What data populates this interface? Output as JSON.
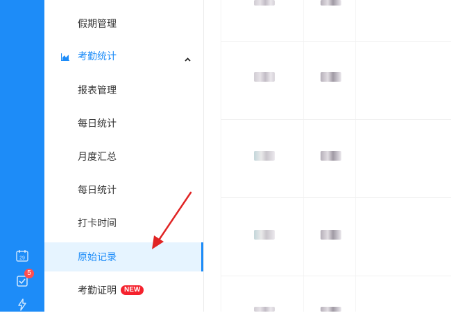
{
  "rail": {
    "calendar_day": "29",
    "task_badge": "5"
  },
  "menu": {
    "items_top": [
      {
        "label": "假期管理"
      }
    ],
    "group": {
      "label": "考勤统计",
      "expanded": true
    },
    "sub_items": [
      {
        "label": "报表管理"
      },
      {
        "label": "每日统计"
      },
      {
        "label": "月度汇总"
      },
      {
        "label": "每日统计"
      },
      {
        "label": "打卡时间"
      },
      {
        "label": "原始记录",
        "active": true
      }
    ],
    "items_bottom": [
      {
        "label": "考勤证明",
        "badge": "NEW"
      }
    ]
  },
  "colors": {
    "accent": "#1d8cf8",
    "active_bg": "#e6f4ff",
    "badge_red": "#f5222d",
    "annotation_arrow": "#e02424"
  }
}
